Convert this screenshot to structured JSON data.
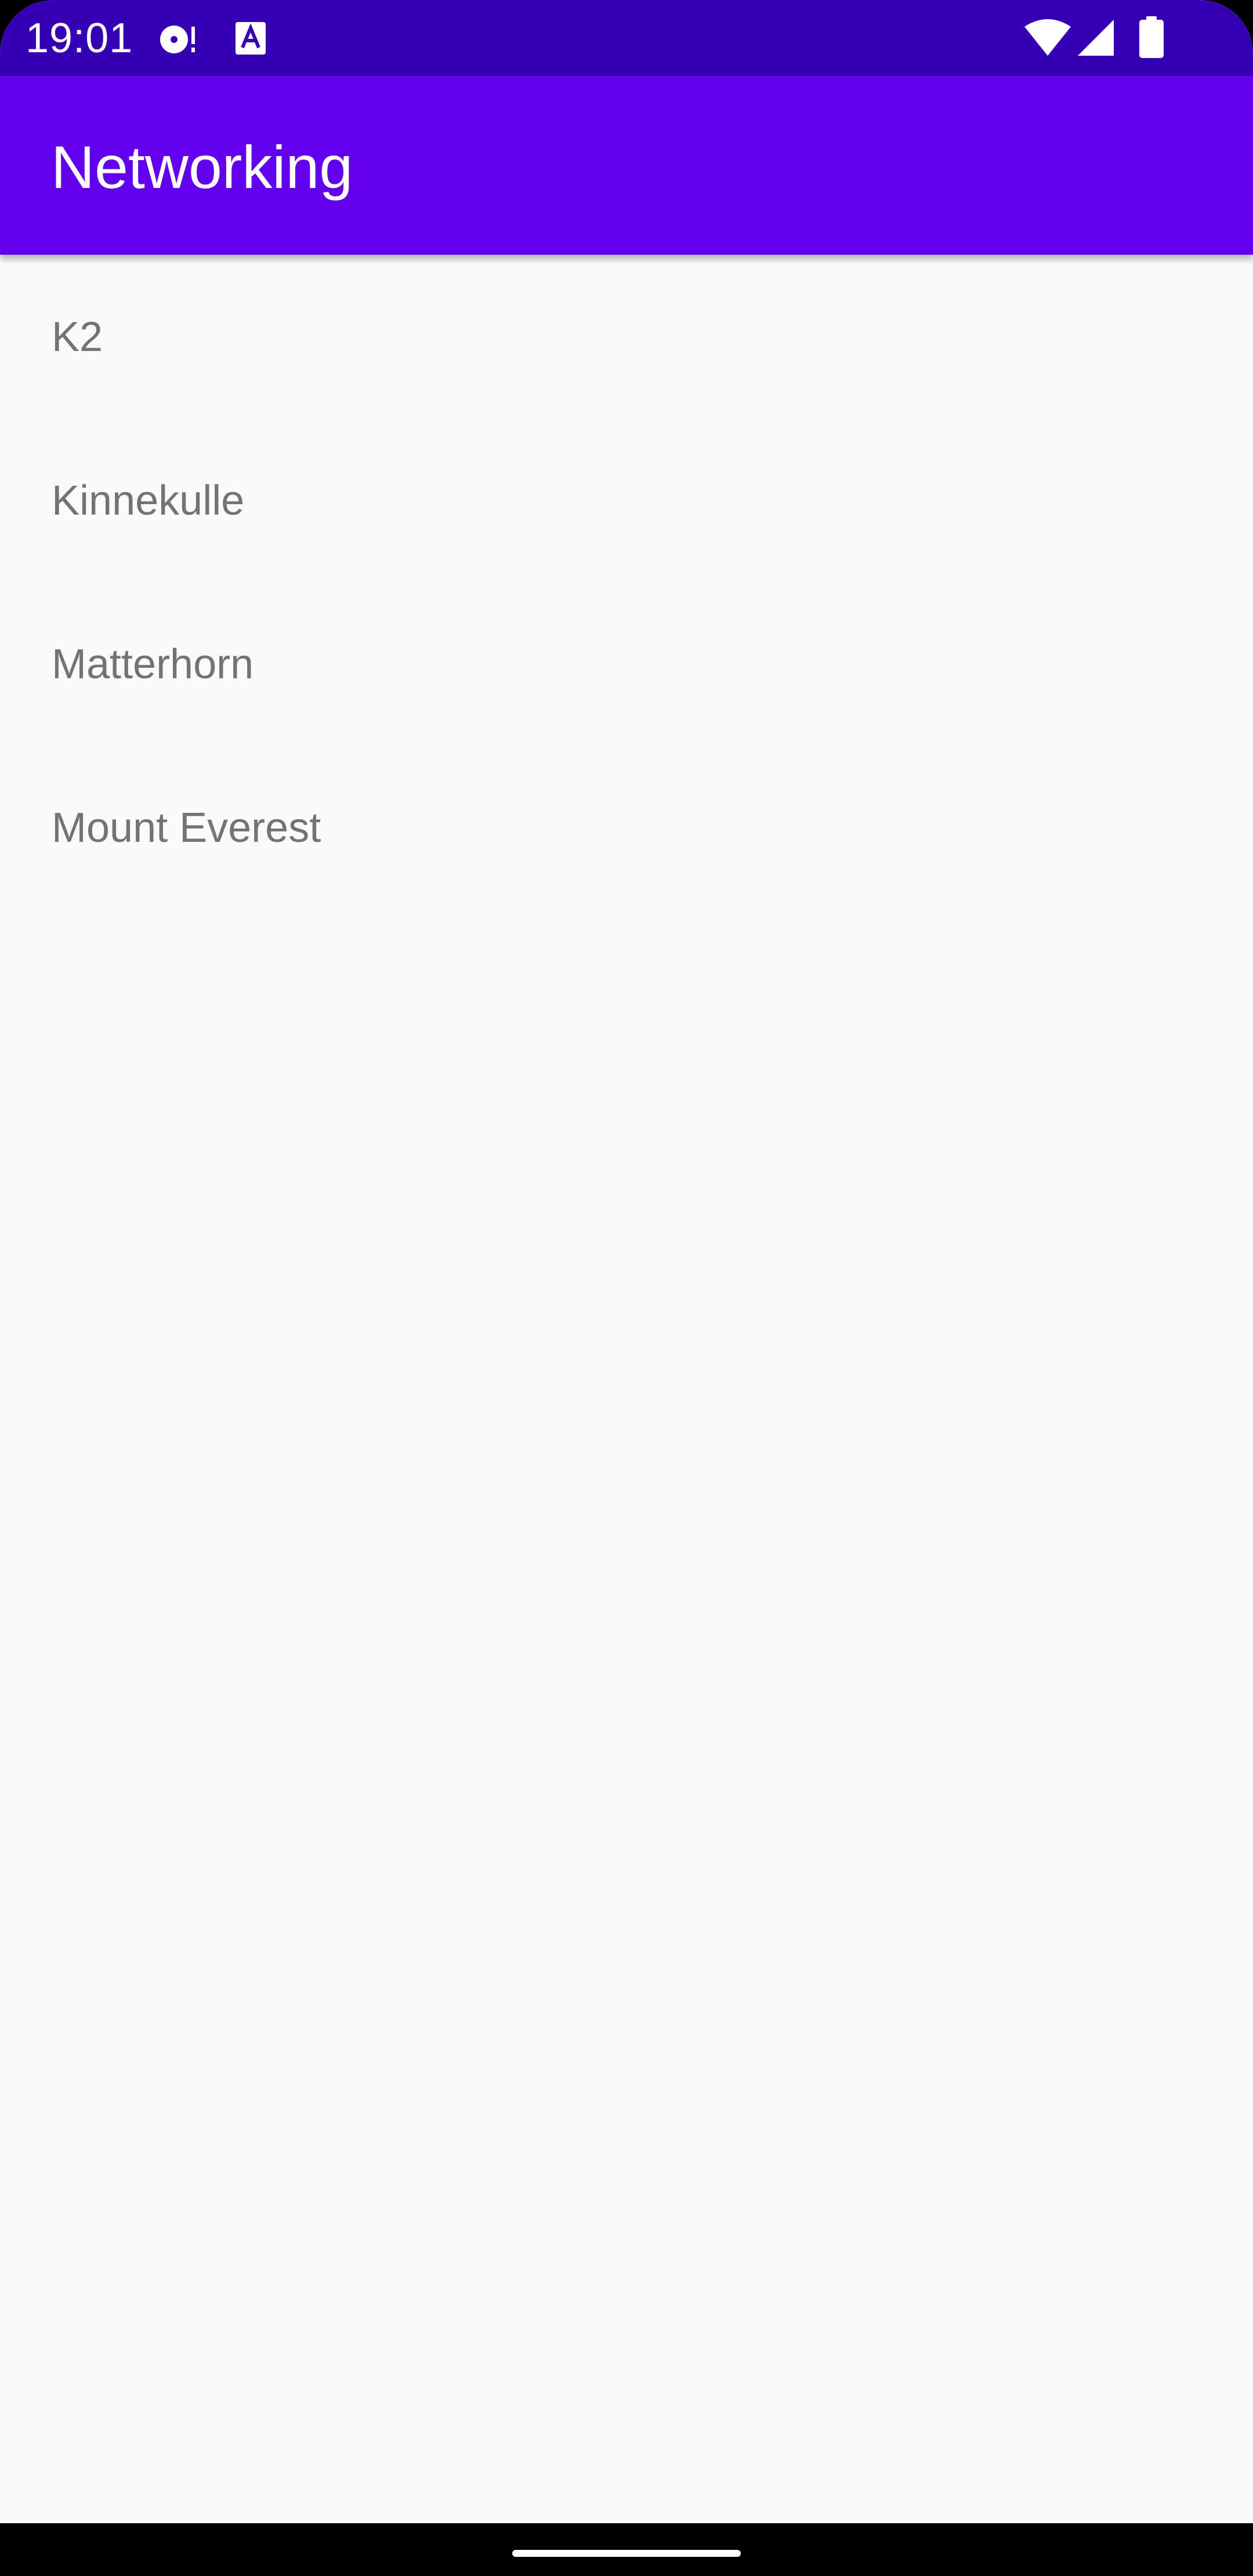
{
  "status_bar": {
    "time": "19:01",
    "icons": [
      "media-disc-icon",
      "text-a-icon",
      "wifi-icon",
      "cell-signal-icon",
      "battery-icon"
    ]
  },
  "app_bar": {
    "title": "Networking"
  },
  "list": {
    "items": [
      {
        "label": "K2"
      },
      {
        "label": "Kinnekulle"
      },
      {
        "label": "Matterhorn"
      },
      {
        "label": "Mount Everest"
      }
    ]
  },
  "colors": {
    "status_bar": "#3700b3",
    "app_bar": "#6200ee",
    "background": "#fafafa",
    "item_text": "#737373"
  }
}
